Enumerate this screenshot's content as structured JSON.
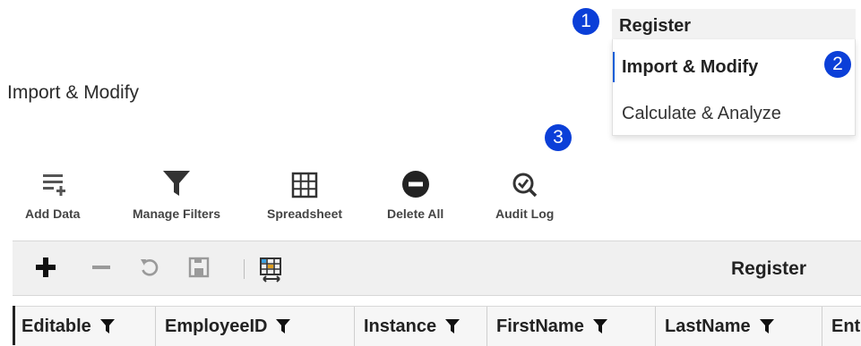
{
  "page_title": "Import & Modify",
  "menu": {
    "header": "Register",
    "items": [
      {
        "label": "Import & Modify",
        "active": true
      },
      {
        "label": "Calculate & Analyze",
        "active": false
      }
    ]
  },
  "callouts": [
    "1",
    "2",
    "3"
  ],
  "toolbar": {
    "buttons": [
      {
        "label": "Add Data",
        "icon": "add-data-icon"
      },
      {
        "label": "Manage Filters",
        "icon": "filter-icon"
      },
      {
        "label": "Spreadsheet",
        "icon": "grid-icon"
      },
      {
        "label": "Delete All",
        "icon": "minus-circle-icon"
      },
      {
        "label": "Audit Log",
        "icon": "audit-search-icon"
      }
    ]
  },
  "grid": {
    "title": "Register",
    "toolbar_icons": [
      "add-row-icon",
      "remove-row-icon",
      "undo-icon",
      "save-icon",
      "column-chooser-icon"
    ],
    "columns": [
      {
        "label": "Editable"
      },
      {
        "label": "EmployeeID"
      },
      {
        "label": "Instance"
      },
      {
        "label": "FirstName"
      },
      {
        "label": "LastName"
      },
      {
        "label": "Ent"
      }
    ]
  },
  "colors": {
    "callout": "#0b3fd8",
    "accent": "#0b5ed7",
    "toolbar_bg": "#f0f0f0"
  }
}
